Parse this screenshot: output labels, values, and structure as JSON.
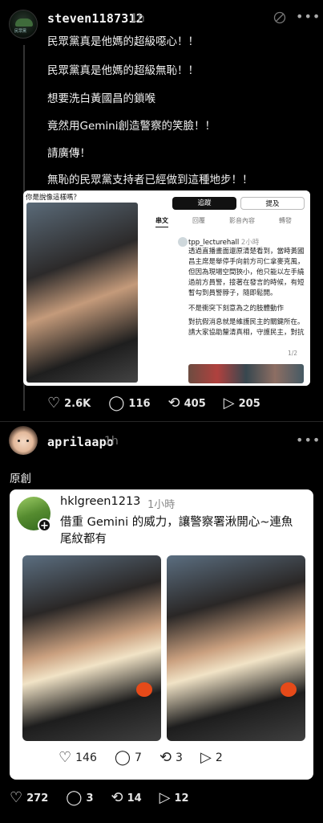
{
  "post1": {
    "username": "steven1187312",
    "time": "1h",
    "avatar_icon": "party-logo-icon",
    "avatar_text": "民眾黨",
    "lines": [
      "民眾黨真是他媽的超級噁心！！",
      "民眾黨真是他媽的超級無恥！！",
      "想要洗白黃國昌的鎖喉",
      "竟然用Gemini創造警察的笑臉！！",
      "請廣傳！",
      "無恥的民眾黨支持者已經做到這種地步！！"
    ],
    "screenshot": {
      "caption": "你是說像這樣嗎？",
      "follow_button": "追蹤",
      "mention_button": "提及",
      "tabs": [
        "串文",
        "回覆",
        "影音內容",
        "轉發"
      ],
      "user": "tpp_lecturehall",
      "time": "2小時",
      "body_1": "透過直播畫面還原清楚看到，當時黃國昌主席是舉停手向前方司仁拿麥克風，但因為現場空間狹小，他只能以左手繞過前方員警，接著在發言的時候，有短暫勾到員警脖子，隨即鬆開。",
      "body_2": "不是衝突下刻意為之的肢體動作",
      "body_3": "對抗假消息就是維護民主的關鍵所在。請大家協助釐清真相，守護民主，對抗假消息。",
      "page": "1/2"
    },
    "stats": {
      "likes": "2.6K",
      "comments": "116",
      "reposts": "405",
      "shares": "205"
    }
  },
  "post2": {
    "username": "aprilaapo",
    "time": "1h",
    "text": "原創",
    "quote": {
      "username": "hklgreen1213",
      "time": "1小時",
      "text": "借重 Gemini 的威力，讓警察署湫開心~連魚尾紋都有",
      "stats": {
        "likes": "146",
        "comments": "7",
        "reposts": "3",
        "shares": "2"
      }
    },
    "stats": {
      "likes": "272",
      "comments": "3",
      "reposts": "14",
      "shares": "12"
    }
  }
}
